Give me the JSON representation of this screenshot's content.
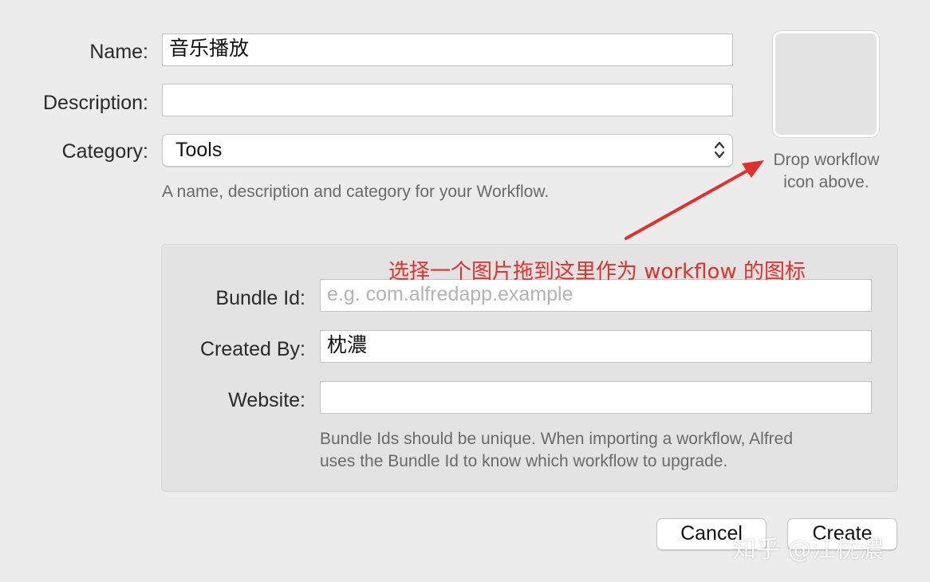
{
  "form": {
    "name_label": "Name:",
    "name_value": "音乐播放",
    "description_label": "Description:",
    "description_value": "",
    "category_label": "Category:",
    "category_value": "Tools",
    "hint": "A name, description and category for your Workflow."
  },
  "icon_well": {
    "caption_line1": "Drop workflow",
    "caption_line2": "icon above."
  },
  "annotation": {
    "text": "选择一个图片拖到这里作为 workflow 的图标",
    "color": "#e0322b"
  },
  "panel": {
    "bundle_label": "Bundle Id:",
    "bundle_value": "",
    "bundle_placeholder": "e.g. com.alfredapp.example",
    "created_label": "Created By:",
    "created_value": "枕濃",
    "website_label": "Website:",
    "website_value": "",
    "hint_line1": "Bundle Ids should be unique. When importing a workflow, Alfred",
    "hint_line2": "uses the Bundle Id to know which workflow to upgrade."
  },
  "buttons": {
    "cancel": "Cancel",
    "create": "Create"
  },
  "watermark": "知乎 @江枕濃"
}
